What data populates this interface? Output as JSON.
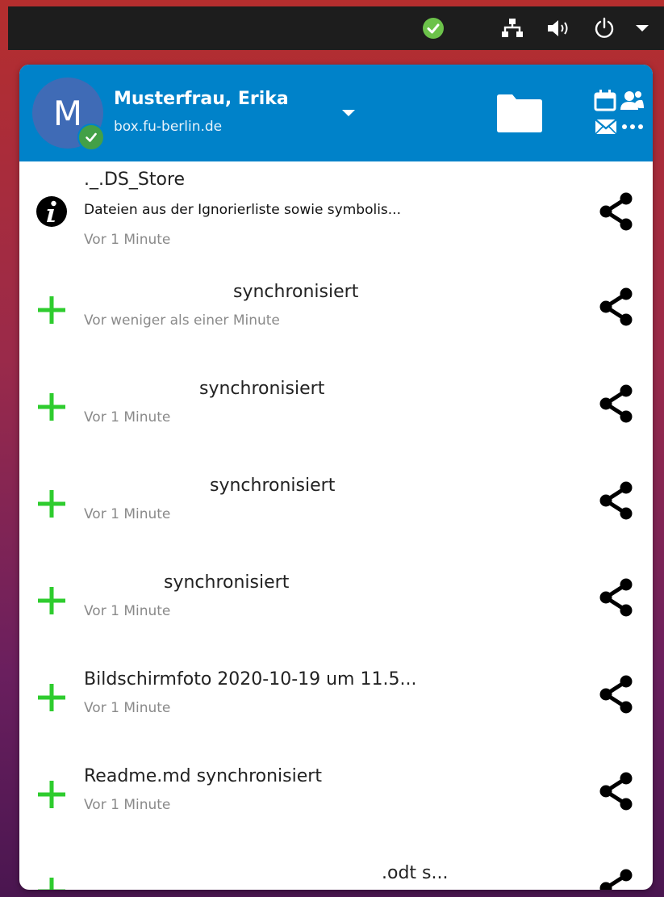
{
  "system_bar": {
    "icons": [
      "status-ok-icon",
      "network-icon",
      "volume-icon",
      "power-icon",
      "chevron-down-icon"
    ]
  },
  "account": {
    "avatar_letter": "M",
    "name": "Musterfrau, Erika",
    "server": "box.fu-berlin.de"
  },
  "activities": [
    {
      "icon": "info-icon",
      "title": "._.DS_Store",
      "message": "Dateien aus der Ignorierliste sowie symbolis...",
      "time": "Vor 1 Minute"
    },
    {
      "icon": "plus-icon",
      "title": "synchronisiert",
      "time": "Vor weniger als einer Minute"
    },
    {
      "icon": "plus-icon",
      "title": "synchronisiert",
      "time": "Vor 1 Minute"
    },
    {
      "icon": "plus-icon",
      "title": "synchronisiert",
      "time": "Vor 1 Minute"
    },
    {
      "icon": "plus-icon",
      "title": "synchronisiert",
      "time": "Vor 1 Minute"
    },
    {
      "icon": "plus-icon",
      "title": "Bildschirmfoto 2020-10-19 um 11.5...",
      "time": "Vor 1 Minute"
    },
    {
      "icon": "plus-icon",
      "title": "Readme.md synchronisiert",
      "time": "Vor 1 Minute"
    },
    {
      "icon": "plus-icon",
      "title": ".odt s...",
      "time": ""
    }
  ],
  "colors": {
    "header": "#0082c9",
    "plus": "#2ecc2e",
    "time_text": "#8a8a8a"
  }
}
